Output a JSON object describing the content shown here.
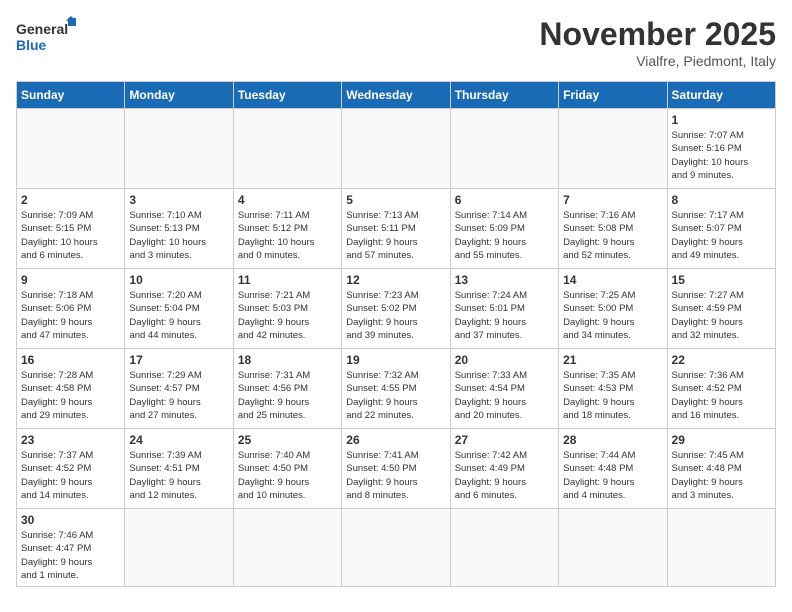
{
  "header": {
    "logo_general": "General",
    "logo_blue": "Blue",
    "month_title": "November 2025",
    "subtitle": "Vialfre, Piedmont, Italy"
  },
  "days_of_week": [
    "Sunday",
    "Monday",
    "Tuesday",
    "Wednesday",
    "Thursday",
    "Friday",
    "Saturday"
  ],
  "weeks": [
    [
      {
        "day": "",
        "info": ""
      },
      {
        "day": "",
        "info": ""
      },
      {
        "day": "",
        "info": ""
      },
      {
        "day": "",
        "info": ""
      },
      {
        "day": "",
        "info": ""
      },
      {
        "day": "",
        "info": ""
      },
      {
        "day": "1",
        "info": "Sunrise: 7:07 AM\nSunset: 5:16 PM\nDaylight: 10 hours\nand 9 minutes."
      }
    ],
    [
      {
        "day": "2",
        "info": "Sunrise: 7:09 AM\nSunset: 5:15 PM\nDaylight: 10 hours\nand 6 minutes."
      },
      {
        "day": "3",
        "info": "Sunrise: 7:10 AM\nSunset: 5:13 PM\nDaylight: 10 hours\nand 3 minutes."
      },
      {
        "day": "4",
        "info": "Sunrise: 7:11 AM\nSunset: 5:12 PM\nDaylight: 10 hours\nand 0 minutes."
      },
      {
        "day": "5",
        "info": "Sunrise: 7:13 AM\nSunset: 5:11 PM\nDaylight: 9 hours\nand 57 minutes."
      },
      {
        "day": "6",
        "info": "Sunrise: 7:14 AM\nSunset: 5:09 PM\nDaylight: 9 hours\nand 55 minutes."
      },
      {
        "day": "7",
        "info": "Sunrise: 7:16 AM\nSunset: 5:08 PM\nDaylight: 9 hours\nand 52 minutes."
      },
      {
        "day": "8",
        "info": "Sunrise: 7:17 AM\nSunset: 5:07 PM\nDaylight: 9 hours\nand 49 minutes."
      }
    ],
    [
      {
        "day": "9",
        "info": "Sunrise: 7:18 AM\nSunset: 5:06 PM\nDaylight: 9 hours\nand 47 minutes."
      },
      {
        "day": "10",
        "info": "Sunrise: 7:20 AM\nSunset: 5:04 PM\nDaylight: 9 hours\nand 44 minutes."
      },
      {
        "day": "11",
        "info": "Sunrise: 7:21 AM\nSunset: 5:03 PM\nDaylight: 9 hours\nand 42 minutes."
      },
      {
        "day": "12",
        "info": "Sunrise: 7:23 AM\nSunset: 5:02 PM\nDaylight: 9 hours\nand 39 minutes."
      },
      {
        "day": "13",
        "info": "Sunrise: 7:24 AM\nSunset: 5:01 PM\nDaylight: 9 hours\nand 37 minutes."
      },
      {
        "day": "14",
        "info": "Sunrise: 7:25 AM\nSunset: 5:00 PM\nDaylight: 9 hours\nand 34 minutes."
      },
      {
        "day": "15",
        "info": "Sunrise: 7:27 AM\nSunset: 4:59 PM\nDaylight: 9 hours\nand 32 minutes."
      }
    ],
    [
      {
        "day": "16",
        "info": "Sunrise: 7:28 AM\nSunset: 4:58 PM\nDaylight: 9 hours\nand 29 minutes."
      },
      {
        "day": "17",
        "info": "Sunrise: 7:29 AM\nSunset: 4:57 PM\nDaylight: 9 hours\nand 27 minutes."
      },
      {
        "day": "18",
        "info": "Sunrise: 7:31 AM\nSunset: 4:56 PM\nDaylight: 9 hours\nand 25 minutes."
      },
      {
        "day": "19",
        "info": "Sunrise: 7:32 AM\nSunset: 4:55 PM\nDaylight: 9 hours\nand 22 minutes."
      },
      {
        "day": "20",
        "info": "Sunrise: 7:33 AM\nSunset: 4:54 PM\nDaylight: 9 hours\nand 20 minutes."
      },
      {
        "day": "21",
        "info": "Sunrise: 7:35 AM\nSunset: 4:53 PM\nDaylight: 9 hours\nand 18 minutes."
      },
      {
        "day": "22",
        "info": "Sunrise: 7:36 AM\nSunset: 4:52 PM\nDaylight: 9 hours\nand 16 minutes."
      }
    ],
    [
      {
        "day": "23",
        "info": "Sunrise: 7:37 AM\nSunset: 4:52 PM\nDaylight: 9 hours\nand 14 minutes."
      },
      {
        "day": "24",
        "info": "Sunrise: 7:39 AM\nSunset: 4:51 PM\nDaylight: 9 hours\nand 12 minutes."
      },
      {
        "day": "25",
        "info": "Sunrise: 7:40 AM\nSunset: 4:50 PM\nDaylight: 9 hours\nand 10 minutes."
      },
      {
        "day": "26",
        "info": "Sunrise: 7:41 AM\nSunset: 4:50 PM\nDaylight: 9 hours\nand 8 minutes."
      },
      {
        "day": "27",
        "info": "Sunrise: 7:42 AM\nSunset: 4:49 PM\nDaylight: 9 hours\nand 6 minutes."
      },
      {
        "day": "28",
        "info": "Sunrise: 7:44 AM\nSunset: 4:48 PM\nDaylight: 9 hours\nand 4 minutes."
      },
      {
        "day": "29",
        "info": "Sunrise: 7:45 AM\nSunset: 4:48 PM\nDaylight: 9 hours\nand 3 minutes."
      }
    ],
    [
      {
        "day": "30",
        "info": "Sunrise: 7:46 AM\nSunset: 4:47 PM\nDaylight: 9 hours\nand 1 minute."
      },
      {
        "day": "",
        "info": ""
      },
      {
        "day": "",
        "info": ""
      },
      {
        "day": "",
        "info": ""
      },
      {
        "day": "",
        "info": ""
      },
      {
        "day": "",
        "info": ""
      },
      {
        "day": "",
        "info": ""
      }
    ]
  ]
}
